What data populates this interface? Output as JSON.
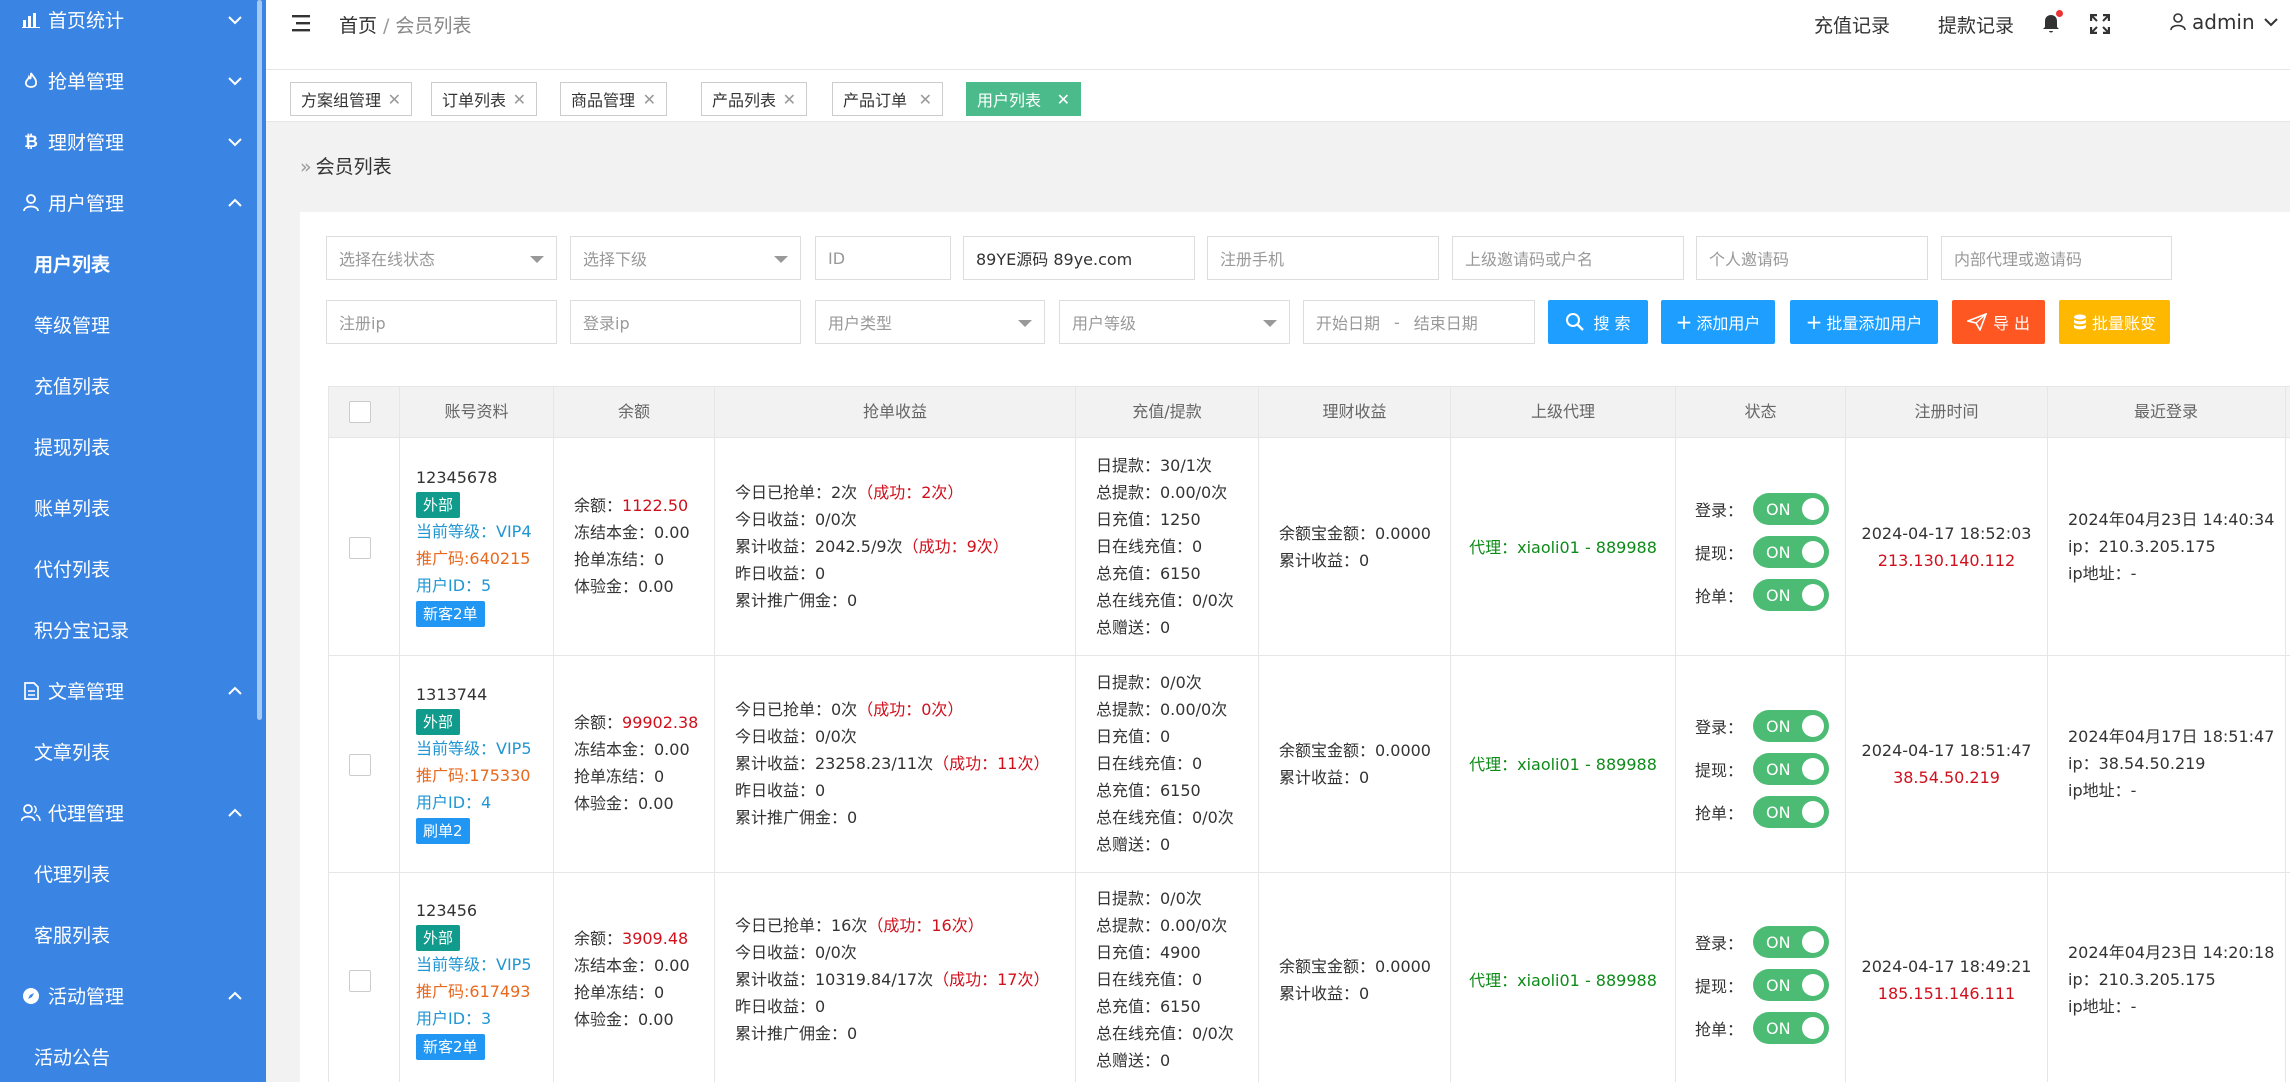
{
  "sidebar": {
    "groups": [
      {
        "label": "首页统计",
        "icon": "bar-chart-icon",
        "expanded": false
      },
      {
        "label": "抢单管理",
        "icon": "fire-icon",
        "expanded": false
      },
      {
        "label": "理财管理",
        "icon": "bitcoin-icon",
        "expanded": false
      },
      {
        "label": "用户管理",
        "icon": "user-icon",
        "expanded": true
      },
      {
        "label": "文章管理",
        "icon": "document-icon",
        "expanded": true
      },
      {
        "label": "代理管理",
        "icon": "users-icon",
        "expanded": true
      },
      {
        "label": "活动管理",
        "icon": "compass-icon",
        "expanded": true
      }
    ],
    "user_items": [
      "用户列表",
      "等级管理",
      "充值列表",
      "提现列表",
      "账单列表",
      "代付列表",
      "积分宝记录"
    ],
    "article_items": [
      "文章列表"
    ],
    "agent_items": [
      "代理列表",
      "客服列表"
    ],
    "activity_items": [
      "活动公告"
    ]
  },
  "header": {
    "breadcrumb_home": "首页",
    "breadcrumb_sep": "/",
    "breadcrumb_current": "会员列表",
    "recharge_link": "充值记录",
    "withdraw_link": "提款记录",
    "username": "admin"
  },
  "tabs": [
    {
      "label": "方案组管理",
      "active": false
    },
    {
      "label": "订单列表",
      "active": false
    },
    {
      "label": "商品管理",
      "active": false
    },
    {
      "label": "产品列表",
      "active": false
    },
    {
      "label": "产品订单",
      "active": false
    },
    {
      "label": "用户列表",
      "active": true
    }
  ],
  "page": {
    "title": "会员列表"
  },
  "filters": {
    "online_status": "选择在线状态",
    "sub_level": "选择下级",
    "id_placeholder": "ID",
    "keyword_value": "89YE源码 89ye.com",
    "phone_placeholder": "注册手机",
    "parent_placeholder": "上级邀请码或户名",
    "invite_placeholder": "个人邀请码",
    "internal_placeholder": "内部代理或邀请码",
    "reg_ip_placeholder": "注册ip",
    "login_ip_placeholder": "登录ip",
    "user_type": "用户类型",
    "user_level": "用户等级",
    "start_date": "开始日期",
    "date_sep": "-",
    "end_date": "结束日期"
  },
  "buttons": {
    "search": "搜 索",
    "add_user": "添加用户",
    "batch_add": "批量添加用户",
    "export": "导 出",
    "batch_change": "批量账变"
  },
  "colors": {
    "sidebar": "#3a85e3",
    "search": "#1e9fff",
    "export": "#ff5722",
    "batch_change": "#ffb800",
    "switch_on": "#4cbb73",
    "tab_active": "#4cbb8b"
  },
  "table": {
    "headers": [
      "账号资料",
      "余额",
      "抢单收益",
      "充值/提款",
      "理财收益",
      "上级代理",
      "状态",
      "注册时间",
      "最近登录"
    ],
    "rows": [
      {
        "account": "12345678",
        "type_badge": "外部",
        "level": "当前等级：VIP4",
        "promo": "推广码:640215",
        "user_id": "用户ID：5",
        "tag": "新客2单",
        "bal_label": "余额：",
        "bal": "1122.50",
        "frozen": "冻结本金：0.00",
        "grab_frozen": "抢单冻结：0",
        "trial": "体验金：0.00",
        "today_grab": "今日已抢单：2次",
        "today_grab_ok": "（成功：2次）",
        "today_income": "今日收益：0/0次",
        "total_income": "累计收益：2042.5/9次",
        "total_income_ok": "（成功：9次）",
        "yesterday": "昨日收益：0",
        "commission": "累计推广佣金：0",
        "day_withdraw": "日提款：30/1次",
        "total_withdraw": "总提款：0.00/0次",
        "day_recharge": "日充值：1250",
        "day_online": "日在线充值：0",
        "total_recharge": "总充值：6150",
        "total_online": "总在线充值：0/0次",
        "total_gift": "总赠送：0",
        "wealth_bal": "余额宝金额：0.0000",
        "wealth_income": "累计收益：0",
        "agent": "代理：xiaoli01 - 889988",
        "sw_login": "登录：",
        "sw_withdraw": "提现：",
        "sw_grab": "抢单：",
        "on": "ON",
        "reg_time": "2024-04-17 18:52:03",
        "reg_ip": "213.130.140.112",
        "last_login": "2024年04月23日 14:40:34",
        "last_ip": "ip：210.3.205.175",
        "ip_addr": "ip地址：-"
      },
      {
        "account": "1313744",
        "type_badge": "外部",
        "level": "当前等级：VIP5",
        "promo": "推广码:175330",
        "user_id": "用户ID：4",
        "tag": "刷单2",
        "bal_label": "余额：",
        "bal": "99902.38",
        "frozen": "冻结本金：0.00",
        "grab_frozen": "抢单冻结：0",
        "trial": "体验金：0.00",
        "today_grab": "今日已抢单：0次",
        "today_grab_ok": "（成功：0次）",
        "today_income": "今日收益：0/0次",
        "total_income": "累计收益：23258.23/11次",
        "total_income_ok": "（成功：11次）",
        "yesterday": "昨日收益：0",
        "commission": "累计推广佣金：0",
        "day_withdraw": "日提款：0/0次",
        "total_withdraw": "总提款：0.00/0次",
        "day_recharge": "日充值：0",
        "day_online": "日在线充值：0",
        "total_recharge": "总充值：6150",
        "total_online": "总在线充值：0/0次",
        "total_gift": "总赠送：0",
        "wealth_bal": "余额宝金额：0.0000",
        "wealth_income": "累计收益：0",
        "agent": "代理：xiaoli01 - 889988",
        "sw_login": "登录：",
        "sw_withdraw": "提现：",
        "sw_grab": "抢单：",
        "on": "ON",
        "reg_time": "2024-04-17 18:51:47",
        "reg_ip": "38.54.50.219",
        "last_login": "2024年04月17日 18:51:47",
        "last_ip": "ip：38.54.50.219",
        "ip_addr": "ip地址：-"
      },
      {
        "account": "123456",
        "type_badge": "外部",
        "level": "当前等级：VIP5",
        "promo": "推广码:617493",
        "user_id": "用户ID：3",
        "tag": "新客2单",
        "bal_label": "余额：",
        "bal": "3909.48",
        "frozen": "冻结本金：0.00",
        "grab_frozen": "抢单冻结：0",
        "trial": "体验金：0.00",
        "today_grab": "今日已抢单：16次",
        "today_grab_ok": "（成功：16次）",
        "today_income": "今日收益：0/0次",
        "total_income": "累计收益：10319.84/17次",
        "total_income_ok": "（成功：17次）",
        "yesterday": "昨日收益：0",
        "commission": "累计推广佣金：0",
        "day_withdraw": "日提款：0/0次",
        "total_withdraw": "总提款：0.00/0次",
        "day_recharge": "日充值：4900",
        "day_online": "日在线充值：0",
        "total_recharge": "总充值：6150",
        "total_online": "总在线充值：0/0次",
        "total_gift": "总赠送：0",
        "wealth_bal": "余额宝金额：0.0000",
        "wealth_income": "累计收益：0",
        "agent": "代理：xiaoli01 - 889988",
        "sw_login": "登录：",
        "sw_withdraw": "提现：",
        "sw_grab": "抢单：",
        "on": "ON",
        "reg_time": "2024-04-17 18:49:21",
        "reg_ip": "185.151.146.111",
        "last_login": "2024年04月23日 14:20:18",
        "last_ip": "ip：210.3.205.175",
        "ip_addr": "ip地址：-"
      }
    ]
  }
}
